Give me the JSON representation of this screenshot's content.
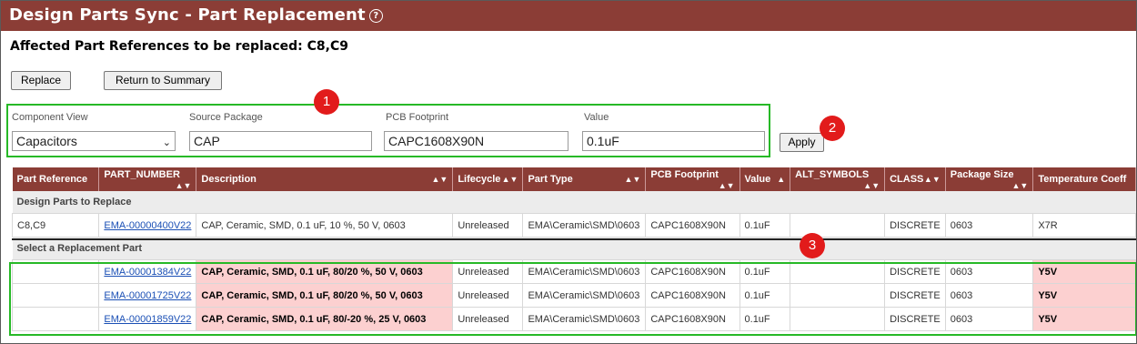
{
  "window": {
    "title": "Design Parts Sync - Part Replacement",
    "help_icon": "help-icon"
  },
  "affected_text": "Affected Part References to be replaced: C8,C9",
  "toolbar": {
    "replace_label": "Replace",
    "return_label": "Return to Summary",
    "apply_label": "Apply"
  },
  "fields": {
    "component_view": {
      "label": "Component View",
      "value": "Capacitors"
    },
    "source_package": {
      "label": "Source Package",
      "value": "CAP"
    },
    "pcb_footprint": {
      "label": "PCB Footprint",
      "value": "CAPC1608X90N"
    },
    "value": {
      "label": "Value",
      "value": "0.1uF"
    }
  },
  "callouts": [
    "1",
    "2",
    "3"
  ],
  "table": {
    "headers": [
      "Part Reference",
      "PART_NUMBER",
      "Description",
      "Lifecycle",
      "Part Type",
      "PCB Footprint",
      "Value",
      "ALT_SYMBOLS",
      "CLASS",
      "Package Size",
      "Temperature Coeff"
    ],
    "section_replace": "Design Parts to Replace",
    "section_select": "Select a Replacement Part",
    "current_row": [
      "C8,C9",
      "EMA-00000400V22",
      "CAP, Ceramic, SMD, 0.1 uF, 10 %, 50 V, 0603",
      "Unreleased",
      "EMA\\Ceramic\\SMD\\0603",
      "CAPC1608X90N",
      "0.1uF",
      "",
      "DISCRETE",
      "0603",
      "X7R"
    ],
    "replacement_rows": [
      [
        "",
        "EMA-00001384V22",
        "CAP, Ceramic, SMD, 0.1 uF, 80/20 %, 50 V, 0603",
        "Unreleased",
        "EMA\\Ceramic\\SMD\\0603",
        "CAPC1608X90N",
        "0.1uF",
        "",
        "DISCRETE",
        "0603",
        "Y5V"
      ],
      [
        "",
        "EMA-00001725V22",
        "CAP, Ceramic, SMD, 0.1 uF, 80/20 %, 50 V, 0603",
        "Unreleased",
        "EMA\\Ceramic\\SMD\\0603",
        "CAPC1608X90N",
        "0.1uF",
        "",
        "DISCRETE",
        "0603",
        "Y5V"
      ],
      [
        "",
        "EMA-00001859V22",
        "CAP, Ceramic, SMD, 0.1 uF, 80/-20 %, 25 V, 0603",
        "Unreleased",
        "EMA\\Ceramic\\SMD\\0603",
        "CAPC1608X90N",
        "0.1uF",
        "",
        "DISCRETE",
        "0603",
        "Y5V"
      ]
    ]
  },
  "colors": {
    "header": "#8b3d36",
    "highlight": "#fcd0d0",
    "callout_box": "#27b927",
    "badge": "#e21b1b"
  }
}
